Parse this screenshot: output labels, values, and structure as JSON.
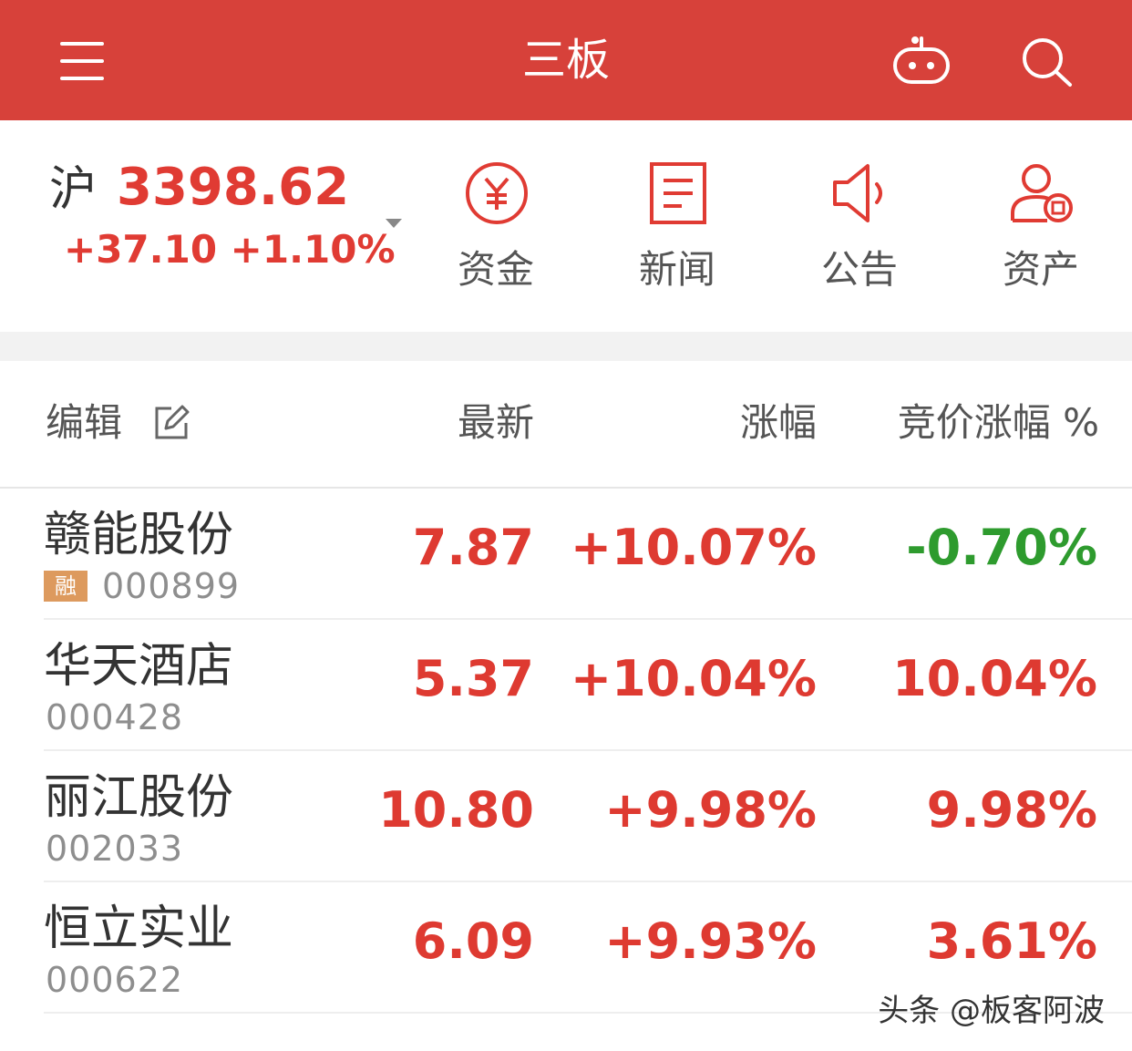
{
  "header": {
    "title": "三板"
  },
  "index": {
    "name": "沪",
    "value": "3398.62",
    "change": "+37.10 +1.10%"
  },
  "quick_actions": [
    {
      "label": "资金",
      "icon": "yuan-circle-icon"
    },
    {
      "label": "新闻",
      "icon": "document-icon"
    },
    {
      "label": "公告",
      "icon": "speaker-icon"
    },
    {
      "label": "资产",
      "icon": "user-asset-icon"
    }
  ],
  "table": {
    "headers": {
      "edit": "编辑",
      "latest": "最新",
      "change": "涨幅",
      "auction": "竞价涨幅 %"
    },
    "rows": [
      {
        "name": "赣能股份",
        "badge": "融",
        "code": "000899",
        "price": "7.87",
        "change": "+10.07%",
        "auction": "-0.70%"
      },
      {
        "name": "华天酒店",
        "code": "000428",
        "price": "5.37",
        "change": "+10.04%",
        "auction": "10.04%"
      },
      {
        "name": "丽江股份",
        "code": "002033",
        "price": "10.80",
        "change": "+9.98%",
        "auction": "9.98%"
      },
      {
        "name": "恒立实业",
        "code": "000622",
        "price": "6.09",
        "change": "+9.93%",
        "auction": "3.61%"
      }
    ]
  },
  "watermark": "头条 @板客阿波",
  "colors": {
    "brand": "#d7413a",
    "up": "#de3a31",
    "down": "#2e9b2e"
  }
}
